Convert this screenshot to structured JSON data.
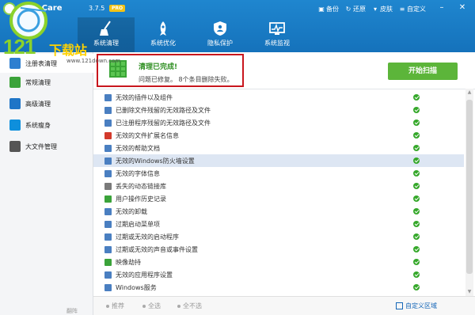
{
  "titlebar": {
    "app_name": "Wise Care",
    "version": "3.7.5",
    "badge": "PRO",
    "actions": [
      {
        "icon": "backup-icon",
        "label": "备份"
      },
      {
        "icon": "restore-icon",
        "label": "还原"
      },
      {
        "icon": "skin-icon",
        "label": "皮肤"
      },
      {
        "icon": "customize-icon",
        "label": "自定义"
      }
    ]
  },
  "nav_tabs": [
    {
      "icon": "broom-icon",
      "label": "系统清理",
      "active": true
    },
    {
      "icon": "rocket-icon",
      "label": "系统优化",
      "active": false
    },
    {
      "icon": "privacy-shield-icon",
      "label": "隐私保护",
      "active": false
    },
    {
      "icon": "monitor-icon",
      "label": "系统监视",
      "active": false
    }
  ],
  "watermark": {
    "big": "121",
    "cn": "下载站",
    "url": "www.121down.com"
  },
  "sidebar": {
    "items": [
      {
        "icon": "registry-icon",
        "label": "注册表清理",
        "color": "#2e7fd0",
        "active": true
      },
      {
        "icon": "check-icon",
        "label": "常规清理",
        "color": "#3ba33a",
        "active": false
      },
      {
        "icon": "advanced-clean-icon",
        "label": "高级清理",
        "color": "#1f75c7",
        "active": false
      },
      {
        "icon": "windows-icon",
        "label": "系统瘦身",
        "color": "#0e8fdc",
        "active": false
      },
      {
        "icon": "folder-icon",
        "label": "大文件管理",
        "color": "#555555",
        "active": false
      }
    ],
    "bottom_text": "翻阵"
  },
  "status": {
    "title": "清理已完成!",
    "description": "问题已修复。  8个条目删除失败。",
    "start_button": "开始扫描"
  },
  "list": {
    "rows": [
      {
        "icon": "plugin-icon",
        "label": "无效的插件以及组件",
        "color": "#4a7fc1"
      },
      {
        "icon": "file-path-icon",
        "label": "已删除文件残留的无效路径及文件",
        "color": "#4a7fc1"
      },
      {
        "icon": "program-path-icon",
        "label": "已注册程序残留的无效路径及文件",
        "color": "#4a7fc1"
      },
      {
        "icon": "file-extension-icon",
        "label": "无效的文件扩展名信息",
        "color": "#d33a2c"
      },
      {
        "icon": "help-doc-icon",
        "label": "无效的帮助文档",
        "color": "#4a7fc1"
      },
      {
        "icon": "firewall-icon",
        "label": "无效的Windows防火墙设置",
        "color": "#4a7fc1",
        "selected": true
      },
      {
        "icon": "font-icon",
        "label": "无效的字体信息",
        "color": "#4a7fc1"
      },
      {
        "icon": "dll-icon",
        "label": "丢失的动态链接库",
        "color": "#7a7a7a"
      },
      {
        "icon": "history-icon",
        "label": "用户操作历史记录",
        "color": "#3ba33a"
      },
      {
        "icon": "uninstall-icon",
        "label": "无效的卸载",
        "color": "#4a7fc1"
      },
      {
        "icon": "startup-menu-icon",
        "label": "过期启动菜单项",
        "color": "#4a7fc1"
      },
      {
        "icon": "startup-program-icon",
        "label": "过期或无效的启动程序",
        "color": "#4a7fc1"
      },
      {
        "icon": "sound-event-icon",
        "label": "过期或无效的声音或事件设置",
        "color": "#4a7fc1"
      },
      {
        "icon": "hijack-icon",
        "label": "映像劫持",
        "color": "#3ba33a"
      },
      {
        "icon": "app-settings-icon",
        "label": "无效的应用程序设置",
        "color": "#4a7fc1"
      },
      {
        "icon": "windows-service-icon",
        "label": "Windows服务",
        "color": "#4a7fc1"
      }
    ]
  },
  "footer": {
    "recommend": "推荐",
    "select_all": "全选",
    "select_none": "全不选",
    "custom_area": "自定义区域"
  },
  "colors": {
    "header": "#1a7ac4",
    "accent_green": "#5cb53a",
    "check_green": "#35a82a",
    "red_frame": "#c8161d"
  }
}
